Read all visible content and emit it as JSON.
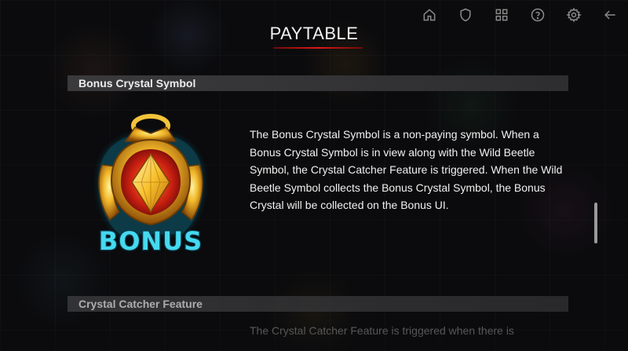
{
  "header": {
    "title": "PAYTABLE",
    "accent_color": "#e01818",
    "icons": [
      "home-icon",
      "shield-icon",
      "grid-icon",
      "help-icon",
      "settings-icon",
      "back-arrow-icon"
    ]
  },
  "sections": [
    {
      "title": "Bonus Crystal Symbol",
      "symbol_label": "BONUS",
      "description": "The Bonus Crystal Symbol is a non-paying symbol. When a Bonus Crystal Symbol is in view along with the Wild Beetle Symbol, the Crystal Catcher Feature is triggered. When the Wild Beetle Symbol collects the Bonus Crystal Symbol, the Bonus Crystal will be collected on the Bonus UI."
    },
    {
      "title": "Crystal Catcher Feature",
      "description": "The Crystal Catcher Feature is triggered when there is"
    }
  ]
}
